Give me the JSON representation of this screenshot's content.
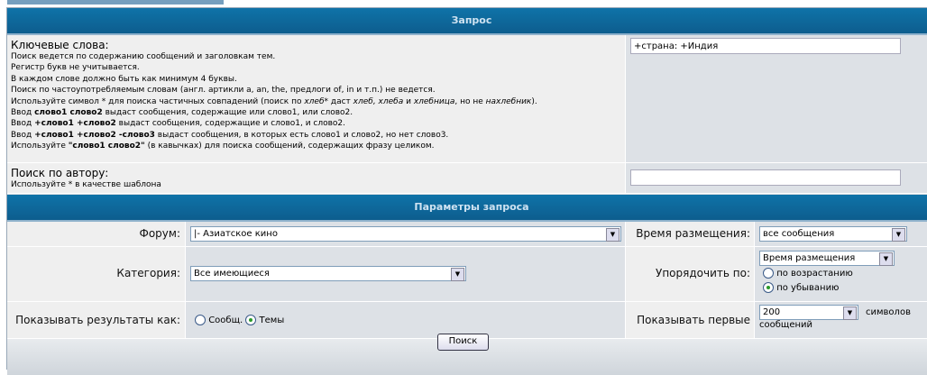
{
  "query": {
    "header": "Запрос",
    "keywords_label": "Ключевые слова:",
    "help": [
      "Поиск ведется по содержанию сообщений и заголовкам тем.",
      "Регистр букв не учитывается.",
      "В каждом слове должно быть как минимум 4 буквы.",
      "Поиск по частоупотребляемым словам (англ. артикли a, an, the, предлоги of, in и т.п.) не ведется."
    ],
    "wildcard": {
      "a": "Используйте символ * для поиска частичных совпадений (поиск по ",
      "b": "хлеб*",
      "c": " даст ",
      "d": "хлеб, хлеба",
      "e": " и ",
      "f": "хлебница",
      "g": ", но не ",
      "h": "нахлебник",
      "i": ")."
    },
    "ex1": {
      "a": "Ввод ",
      "b": "слово1 слово2",
      "c": " выдаст сообщения, содержащие или слово1, или слово2."
    },
    "ex2": {
      "a": "Ввод ",
      "b": "+слово1 +слово2",
      "c": " выдаст сообщения, содержащие и слово1, и слово2."
    },
    "ex3": {
      "a": "Ввод ",
      "b": "+слово1 +слово2 -слово3",
      "c": " выдаст сообщения, в которых есть слово1 и слово2, но нет слово3."
    },
    "ex4": {
      "a": "Используйте ",
      "b": "\"слово1 слово2\"",
      "c": " (в кавычках) для поиска сообщений, содержащих фразу целиком."
    },
    "keywords_value": "+страна: +Индия",
    "author_label": "Поиск по автору:",
    "author_help": "Используйте * в качестве шаблона",
    "author_value": ""
  },
  "params": {
    "header": "Параметры запроса",
    "forum_label": "Форум:",
    "forum_value": "|- Азиатское кино",
    "time_label": "Время размещения:",
    "time_value": "все сообщения",
    "category_label": "Категория:",
    "category_value": "Все имеющиеся",
    "sort_label": "Упорядочить по:",
    "sort_value": "Время размещения",
    "asc": "по возрастанию",
    "desc": "по убыванию",
    "sort_dir": "desc",
    "show_label": "Показывать результаты как:",
    "show_posts": "Сообщ.",
    "show_topics": "Темы",
    "show_selected": "topics",
    "first_label": "Показывать первые",
    "first_value": "200",
    "chars_label": "символов сообщений"
  },
  "search_button": "Поиск"
}
